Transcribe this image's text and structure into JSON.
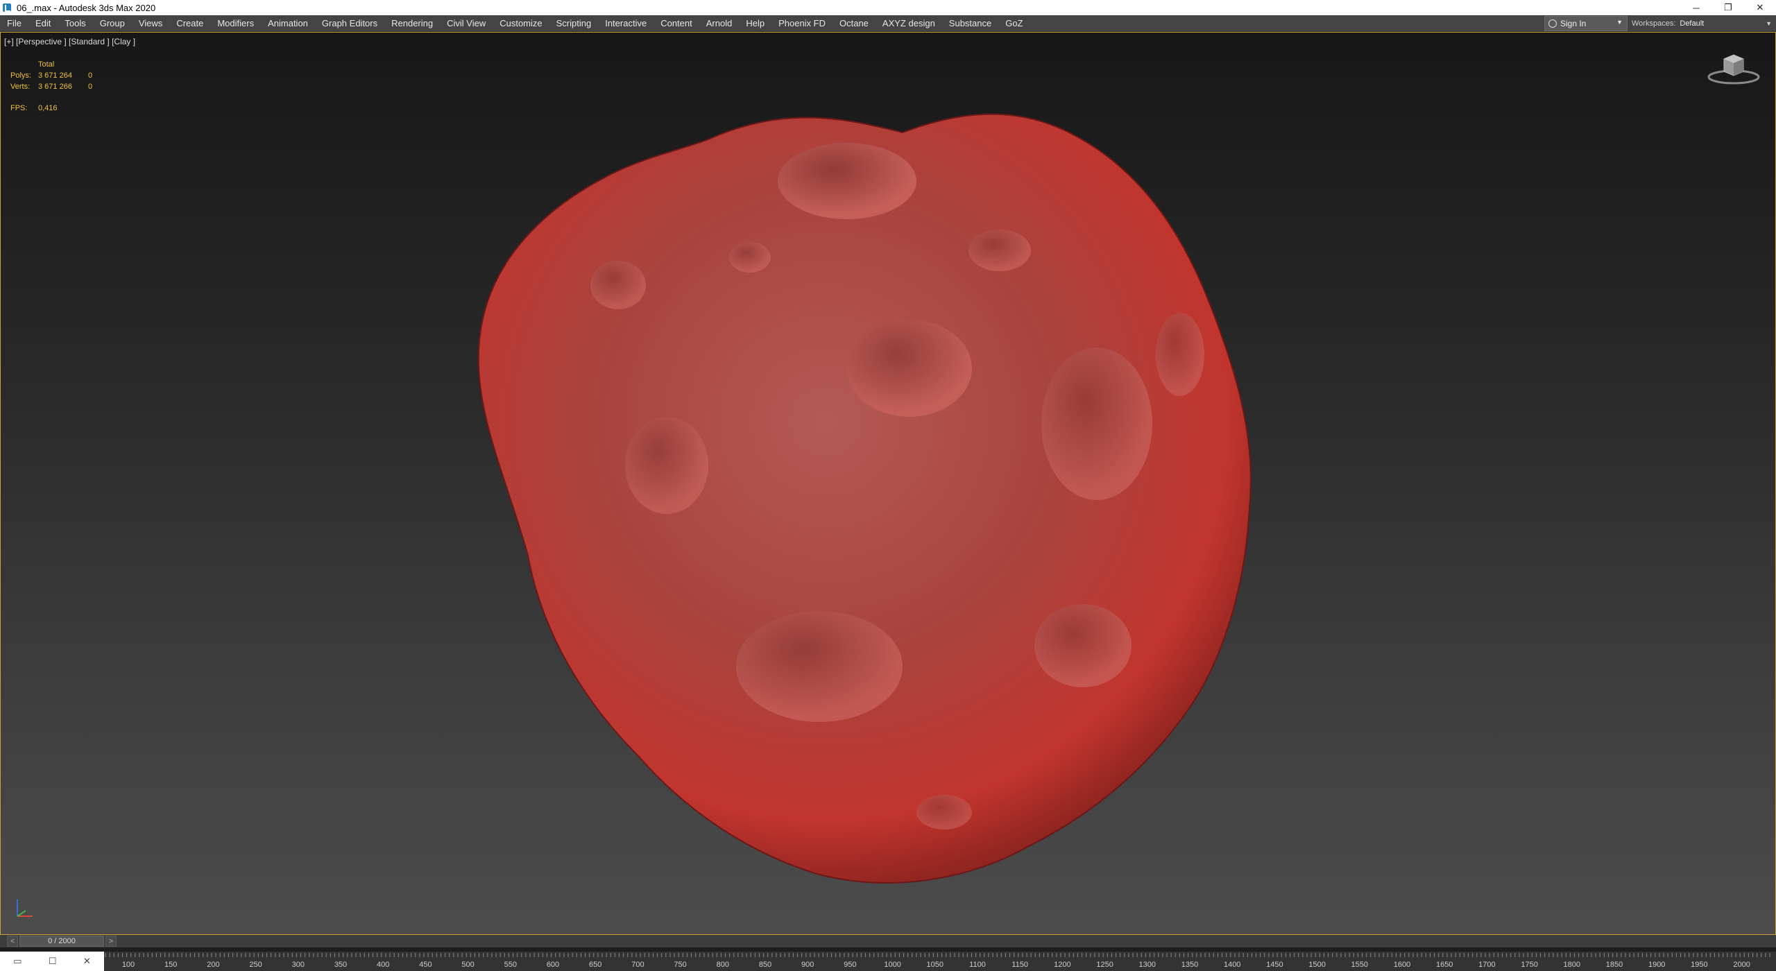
{
  "window": {
    "title": "06_.max - Autodesk 3ds Max 2020",
    "controls": {
      "minimize": "─",
      "restore": "❐",
      "close": "✕"
    }
  },
  "menu": {
    "items": [
      "File",
      "Edit",
      "Tools",
      "Group",
      "Views",
      "Create",
      "Modifiers",
      "Animation",
      "Graph Editors",
      "Rendering",
      "Civil View",
      "Customize",
      "Scripting",
      "Interactive",
      "Content",
      "Arnold",
      "Help",
      "Phoenix FD",
      "Octane",
      "AXYZ design",
      "Substance",
      "GoZ"
    ]
  },
  "account": {
    "sign_in": "Sign In",
    "workspaces_label": "Workspaces:",
    "workspace_value": "Default"
  },
  "viewport": {
    "label": "[+] [Perspective ] [Standard ] [Clay ]",
    "stats": {
      "header": "Total",
      "polys_label": "Polys:",
      "polys_total": "3 671 264",
      "polys_selected": "0",
      "verts_label": "Verts:",
      "verts_total": "3 671 266",
      "verts_selected": "0",
      "fps_label": "FPS:",
      "fps_value": "0,416"
    },
    "object_color": "#c0403a"
  },
  "timeline": {
    "frame": "0 / 2000",
    "ticks": [
      "100",
      "150",
      "200",
      "250",
      "300",
      "350",
      "400",
      "450",
      "500",
      "550",
      "600",
      "650",
      "700",
      "750",
      "800",
      "850",
      "900",
      "950",
      "1000",
      "1050",
      "1100",
      "1150",
      "1200",
      "1250",
      "1300",
      "1350",
      "1400",
      "1450",
      "1500",
      "1550",
      "1600",
      "1650",
      "1700",
      "1750",
      "1800",
      "1850",
      "1900",
      "1950",
      "2000"
    ]
  },
  "colors": {
    "accent": "#c8a23a",
    "stats_text": "#f0c23a",
    "menubar": "#444444"
  }
}
